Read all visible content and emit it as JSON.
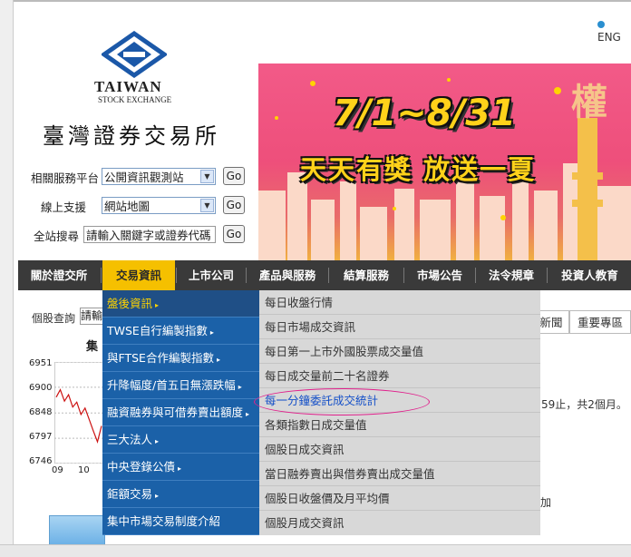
{
  "header": {
    "lang_link": "ENG",
    "logo_en": "TAIWAN",
    "logo_sub": "STOCK EXCHANGE",
    "logo_zh": "臺灣證券交易所"
  },
  "forms": [
    {
      "label": "相關服務平台",
      "value": "公開資訊觀測站",
      "button": "Go"
    },
    {
      "label": "線上支援",
      "value": "網站地圖",
      "button": "Go"
    },
    {
      "label": "全站搜尋",
      "value": "請輸入關鍵字或證券代碼",
      "button": "Go"
    }
  ],
  "banner": {
    "date_text": "7/1~8/31",
    "slogan": "天天有獎 放送一夏",
    "corner_char": "權"
  },
  "nav": {
    "items": [
      "關於證交所",
      "交易資訊",
      "上市公司",
      "產品與服務",
      "結算服務",
      "市場公告",
      "法令規章",
      "投資人教育"
    ],
    "active_index": 1
  },
  "menu_level1": [
    {
      "label": "盤後資訊",
      "arrow": "▸",
      "active": true
    },
    {
      "label": "TWSE自行編製指數",
      "arrow": "▸"
    },
    {
      "label": "與FTSE合作編製指數",
      "arrow": "▸"
    },
    {
      "label": "升降幅度/首五日無漲跌幅",
      "arrow": "▸"
    },
    {
      "label": "融資融券與可借券賣出額度",
      "arrow": "▸"
    },
    {
      "label": "三大法人",
      "arrow": "▸"
    },
    {
      "label": "中央登錄公債",
      "arrow": "▸"
    },
    {
      "label": "鉅額交易",
      "arrow": "▸"
    },
    {
      "label": "集中市場交易制度介紹",
      "arrow": ""
    }
  ],
  "menu_level2": [
    {
      "label": "每日收盤行情"
    },
    {
      "label": "每日市場成交資訊"
    },
    {
      "label": "每日第一上市外國股票成交量值"
    },
    {
      "label": "每日成交量前二十名證券"
    },
    {
      "label": "每一分鐘委託成交統計",
      "highlight": true
    },
    {
      "label": "各類指數日成交量值"
    },
    {
      "label": "個股日成交資訊"
    },
    {
      "label": "當日融券賣出與借券賣出成交量值"
    },
    {
      "label": "個股日收盤價及月平均價"
    },
    {
      "label": "個股月成交資訊"
    }
  ],
  "quote": {
    "label": "個股查詢",
    "input_value": "請輸"
  },
  "chart_data": {
    "type": "line",
    "title": "集",
    "y_ticks": [
      6951,
      6900,
      6848,
      6797,
      6746
    ],
    "x_ticks": [
      "09",
      "10"
    ],
    "ylim": [
      6746,
      6951
    ],
    "series": [
      {
        "values": [
          6880,
          6895,
          6872,
          6885,
          6860,
          6870,
          6845,
          6858,
          6835,
          6812,
          6790,
          6822
        ]
      }
    ],
    "colors": {
      "line": "#cc1111"
    },
    "grid": true
  },
  "right_panel": {
    "tabs": [
      "新聞",
      "重要專區"
    ],
    "text1": "59止，共2個月。",
    "text2": "加"
  }
}
